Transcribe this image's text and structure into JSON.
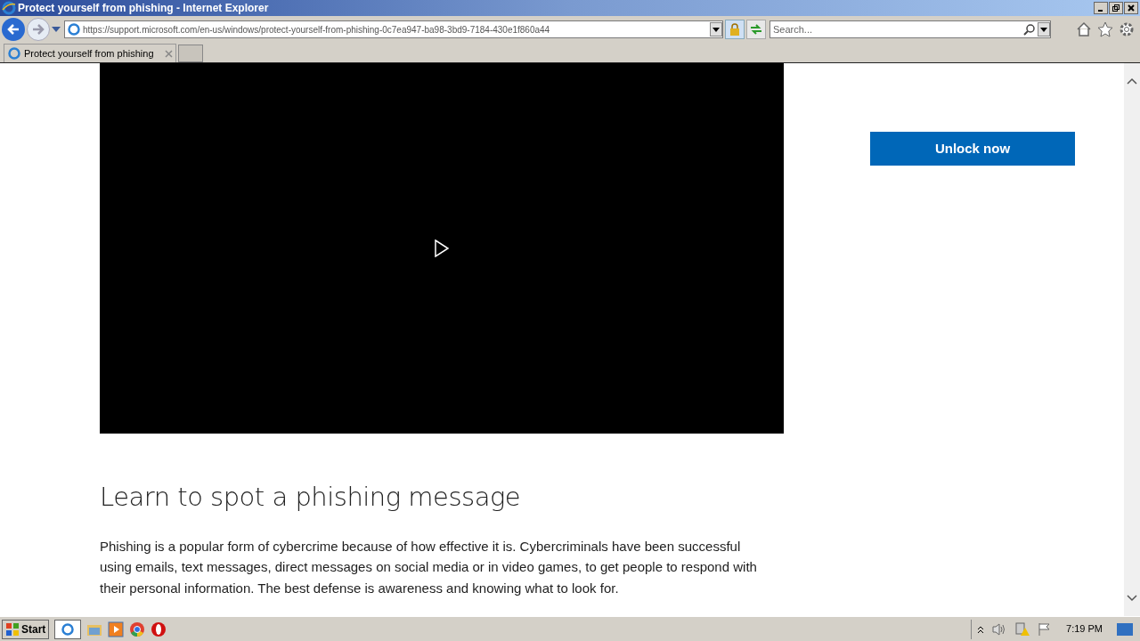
{
  "window": {
    "title": "Protect yourself from phishing - Internet Explorer"
  },
  "address_bar": {
    "url": "https://support.microsoft.com/en-us/windows/protect-yourself-from-phishing-0c7ea947-ba98-3bd9-7184-430e1f860a44"
  },
  "search": {
    "placeholder": "Search..."
  },
  "tabs": [
    {
      "label": "Protect yourself from phishing",
      "selected": true
    }
  ],
  "page": {
    "button": "Unlock now",
    "heading": "Learn to spot a phishing message",
    "paragraph": "Phishing is a popular form of cybercrime because of how effective it is. Cybercriminals have been successful using emails, text messages, direct messages on social media or in video games, to get people to respond with their personal information. The best defense is awareness and knowing what to look for."
  },
  "taskbar": {
    "start": "Start",
    "clock": "7:19 PM"
  }
}
